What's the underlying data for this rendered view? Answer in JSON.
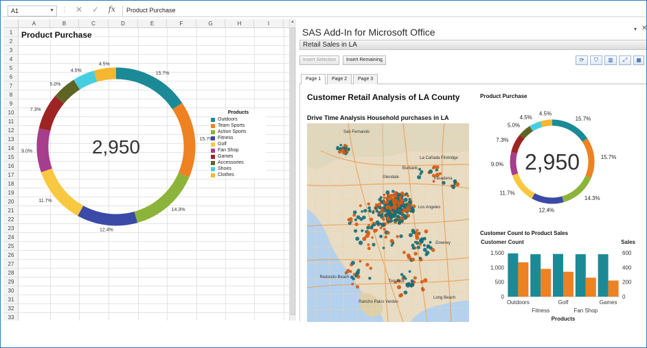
{
  "formula_bar": {
    "name_box": "A1",
    "cancel_symbol": "✕",
    "enter_symbol": "✓",
    "fx_label": "fx",
    "value": "Product Purchase"
  },
  "sheet": {
    "columns": [
      "A",
      "B",
      "C",
      "D",
      "E",
      "F",
      "G",
      "H",
      "I"
    ],
    "rows": [
      "1",
      "2",
      "3",
      "4",
      "5",
      "6",
      "7",
      "8",
      "9",
      "10",
      "11",
      "12",
      "13",
      "14",
      "15",
      "16",
      "17",
      "18",
      "19",
      "20",
      "21",
      "22",
      "23",
      "24",
      "25",
      "26",
      "27",
      "28",
      "29",
      "30",
      "31",
      "32",
      "33"
    ],
    "title": "Product Purchase",
    "legend_title": "Products"
  },
  "sas": {
    "pane_title": "SAS Add-In for Microsoft Office",
    "pane_menu_icon": "▾",
    "pane_close_icon": "✕",
    "report_name": "Retail Sales in LA",
    "insert_selection": "Insert Selection",
    "insert_remaining": "Insert Remaining",
    "icons": [
      "refresh-icon",
      "filter-icon",
      "chart-icon",
      "expand-icon",
      "grid-icon"
    ],
    "tabs": [
      {
        "label": "Page 1",
        "active": true
      },
      {
        "label": "Page 2",
        "active": false
      },
      {
        "label": "Page 3",
        "active": false
      }
    ],
    "dashboard_title": "Customer Retail Analysis of LA County",
    "map_title": "Drive Time Analysis Household purchases in LA",
    "map_labels": [
      "San Fernando",
      "Burbank",
      "La Cañada Flintridge",
      "Glendale",
      "Pasadena",
      "Los Angeles",
      "Downey",
      "Redondo Beach",
      "Torrance",
      "Long Beach",
      "Rancho Palos Verdes"
    ],
    "donut_title": "Product Purchase",
    "bar_title": "Customer Count to Product Sales"
  },
  "colors": {
    "Outdoors": "#1b8a96",
    "Team Sports": "#ee8122",
    "Action Sports": "#8db43a",
    "Fitness": "#3b4aa6",
    "Golf": "#f9c841",
    "Fan Shop": "#a63e8d",
    "Games": "#9e2424",
    "Accessories": "#5e6424",
    "Shoes": "#48cde0",
    "Clothes": "#f5b730",
    "water": "#b4d1ee",
    "land": "#e8dcc4",
    "teal_dot": "#136d78",
    "orange_dot": "#d45b14"
  },
  "chart_data": [
    {
      "type": "pie",
      "chart": "donut",
      "title": "Product Purchase",
      "center_label": "2,950",
      "legend_title": "Products",
      "slices": [
        {
          "name": "Outdoors",
          "value": 15.7,
          "label": "15.7%"
        },
        {
          "name": "Team Sports",
          "value": 15.7,
          "label": "15.7%"
        },
        {
          "name": "Action Sports",
          "value": 14.3,
          "label": "14.3%"
        },
        {
          "name": "Fitness",
          "value": 12.4,
          "label": "12.4%"
        },
        {
          "name": "Golf",
          "value": 11.7,
          "label": "11.7%"
        },
        {
          "name": "Fan Shop",
          "value": 9.0,
          "label": "9.0%"
        },
        {
          "name": "Games",
          "value": 7.3,
          "label": "7.3%"
        },
        {
          "name": "Accessories",
          "value": 5.0,
          "label": "5.0%"
        },
        {
          "name": "Shoes",
          "value": 4.5,
          "label": "4.5%"
        },
        {
          "name": "Clothes",
          "value": 4.5,
          "label": "4.5%"
        }
      ]
    },
    {
      "type": "bar",
      "title": "Customer Count to Product Sales",
      "categories": [
        "Outdoors",
        "Fitness",
        "Golf",
        "Fan Shop",
        "Games"
      ],
      "xlabel": "Products",
      "ylabel": "Customer Count",
      "y2label": "Sales",
      "ylim": [
        0,
        1500
      ],
      "y2lim": [
        0,
        600
      ],
      "yticks": [
        "0",
        "500",
        "1,000",
        "1,500"
      ],
      "y2ticks": [
        "0",
        "200",
        "400",
        "600"
      ],
      "series": [
        {
          "name": "Customer Count",
          "axis": "left",
          "values": [
            1480,
            1450,
            1460,
            1450,
            1450
          ]
        },
        {
          "name": "Sales",
          "axis": "right",
          "values": [
            470,
            380,
            340,
            260,
            220
          ]
        }
      ]
    }
  ]
}
